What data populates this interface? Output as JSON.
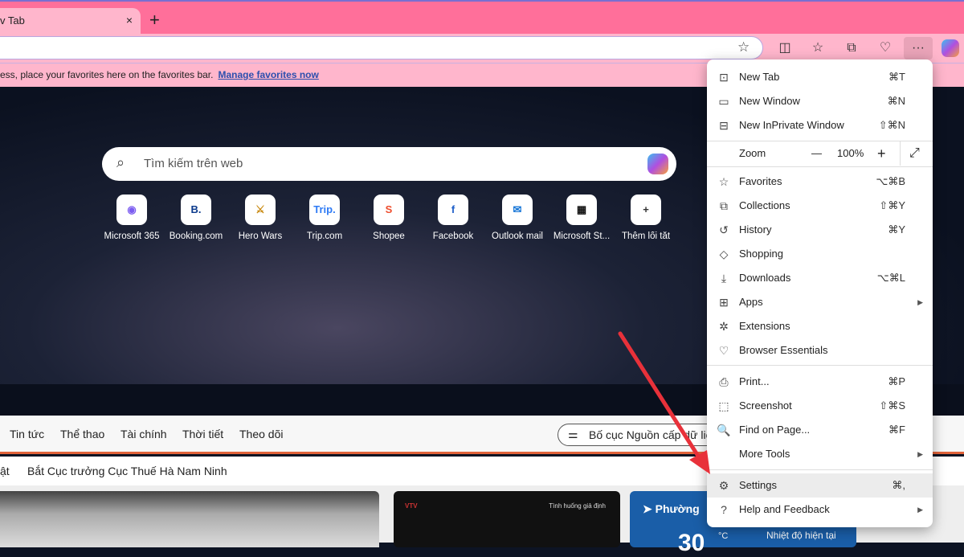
{
  "tab": {
    "title": "v Tab",
    "close": "×",
    "new_tab": "+"
  },
  "toolbar": {
    "icons": [
      "star-icon",
      "split-screen-icon",
      "favorites-icon",
      "collections-icon",
      "browser-essentials-icon",
      "more-icon",
      "copilot-icon"
    ],
    "more": "···",
    "star": "☆"
  },
  "favbar": {
    "text": "ess, place your favorites here on the favorites bar.",
    "link": "Manage favorites now"
  },
  "search": {
    "placeholder": "Tìm kiếm trên web"
  },
  "shortcuts": [
    {
      "label": "Microsoft 365",
      "glyph": "◉",
      "color": "#7b5cf0"
    },
    {
      "label": "Booking.com",
      "glyph": "B.",
      "color": "#0b3a8c"
    },
    {
      "label": "Hero Wars",
      "glyph": "⚔",
      "color": "#c98a12"
    },
    {
      "label": "Trip.com",
      "glyph": "Trip.",
      "color": "#2f7bf5"
    },
    {
      "label": "Shopee",
      "glyph": "S",
      "color": "#ee4d2d"
    },
    {
      "label": "Facebook",
      "glyph": "f",
      "color": "#1f5fc9"
    },
    {
      "label": "Outlook mail",
      "glyph": "✉",
      "color": "#1273d6"
    },
    {
      "label": "Microsoft St...",
      "glyph": "▦",
      "color": "#111"
    },
    {
      "label": "Thêm lối tắt",
      "glyph": "+",
      "color": "#333"
    }
  ],
  "news": {
    "tabs": [
      "Tin tức",
      "Thể thao",
      "Tài chính",
      "Thời tiết",
      "Theo dõi"
    ],
    "layout_button": "Bố cục Nguồn cấp dữ liệu",
    "ticker_prefix": "ật",
    "ticker": "Bắt Cục trưởng Cục Thuế Hà Nam Ninh"
  },
  "cards": {
    "video_brand": "VTV",
    "video_caption": "Tình huống giả định",
    "weather_location": "Phường",
    "weather_temp": "30",
    "weather_unit": "°C",
    "weather_label": "Nhiệt độ hiện tại"
  },
  "menu": {
    "items": [
      {
        "label": "New Tab",
        "shortcut": "⌘T",
        "icon": "new-tab-icon",
        "glyph": "⊡"
      },
      {
        "label": "New Window",
        "shortcut": "⌘N",
        "icon": "new-window-icon",
        "glyph": "▭"
      },
      {
        "label": "New InPrivate Window",
        "shortcut": "⇧⌘N",
        "icon": "inprivate-icon",
        "glyph": "⊟"
      },
      {
        "label": "Favorites",
        "shortcut": "⌥⌘B",
        "icon": "favorites-icon",
        "glyph": "☆"
      },
      {
        "label": "Collections",
        "shortcut": "⇧⌘Y",
        "icon": "collections-icon",
        "glyph": "⧉"
      },
      {
        "label": "History",
        "shortcut": "⌘Y",
        "icon": "history-icon",
        "glyph": "↺"
      },
      {
        "label": "Shopping",
        "shortcut": "",
        "icon": "shopping-tag-icon",
        "glyph": "◇"
      },
      {
        "label": "Downloads",
        "shortcut": "⌥⌘L",
        "icon": "download-icon",
        "glyph": "⤓"
      },
      {
        "label": "Apps",
        "shortcut": "",
        "icon": "apps-icon",
        "glyph": "⊞",
        "submenu": true
      },
      {
        "label": "Extensions",
        "shortcut": "",
        "icon": "extensions-icon",
        "glyph": "✲"
      },
      {
        "label": "Browser Essentials",
        "shortcut": "",
        "icon": "heart-pulse-icon",
        "glyph": "♡"
      },
      {
        "label": "Print...",
        "shortcut": "⌘P",
        "icon": "printer-icon",
        "glyph": "⎙"
      },
      {
        "label": "Screenshot",
        "shortcut": "⇧⌘S",
        "icon": "screenshot-icon",
        "glyph": "⬚"
      },
      {
        "label": "Find on Page...",
        "shortcut": "⌘F",
        "icon": "find-icon",
        "glyph": "🔍"
      },
      {
        "label": "More Tools",
        "shortcut": "",
        "icon": "",
        "glyph": "",
        "submenu": true
      },
      {
        "label": "Settings",
        "shortcut": "⌘,",
        "icon": "gear-icon",
        "glyph": "⚙",
        "highlighted": true
      },
      {
        "label": "Help and Feedback",
        "shortcut": "",
        "icon": "help-icon",
        "glyph": "?",
        "submenu": true
      }
    ],
    "zoom": {
      "label": "Zoom",
      "minus": "—",
      "value": "100%",
      "plus": "+",
      "fullscreen": "⤢"
    }
  },
  "annotation": {
    "arrow_color": "#e8313a"
  }
}
